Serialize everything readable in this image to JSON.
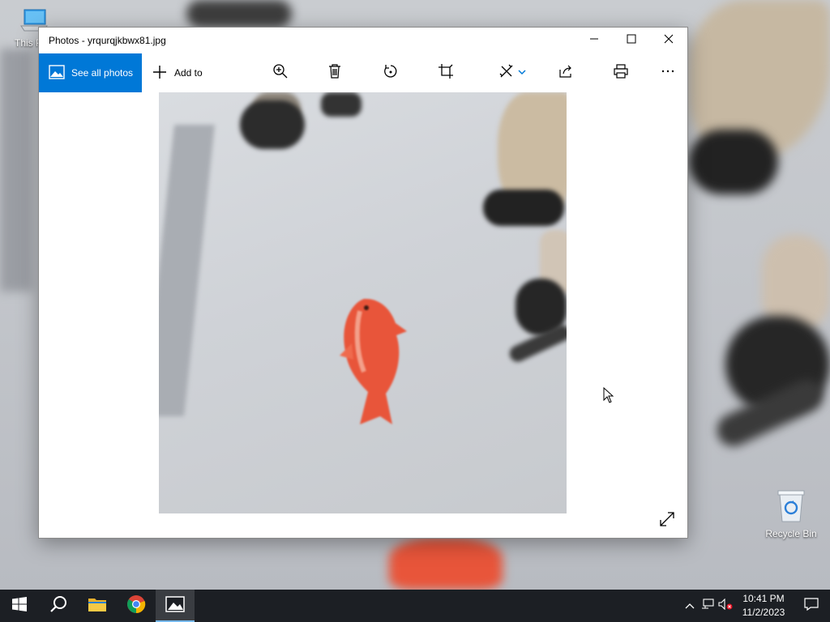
{
  "desktop": {
    "icons": [
      {
        "label": "This PC"
      },
      {
        "label": "Recycle Bin"
      }
    ]
  },
  "window": {
    "title": "Photos - yrqurqjkbwx81.jpg",
    "controls": {
      "minimize": "minimize-icon",
      "maximize": "maximize-icon",
      "close": "close-icon"
    },
    "toolbar": {
      "see_all_label": "See all photos",
      "add_to_label": "Add to",
      "icons": [
        "zoom-in-icon",
        "delete-icon",
        "rotate-icon",
        "crop-icon",
        "edit-enhance-icon",
        "share-icon",
        "print-icon",
        "more-icon"
      ]
    },
    "accent_color": "#0078d7"
  },
  "taskbar": {
    "apps": [
      "start-icon",
      "search-icon",
      "file-explorer-icon",
      "chrome-icon",
      "photos-icon"
    ],
    "active_app": "photos-icon",
    "clock": {
      "time": "10:41 PM",
      "date": "11/2/2023"
    }
  }
}
